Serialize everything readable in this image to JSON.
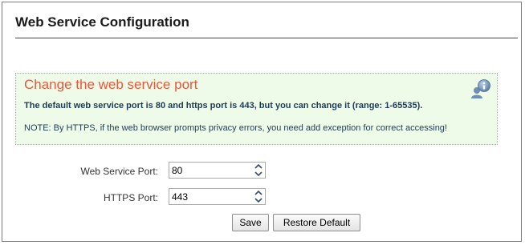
{
  "page": {
    "title": "Web Service Configuration"
  },
  "info": {
    "heading": "Change the web service port",
    "main_text": "The default web service port is 80 and https port is 443, but you can change it (range: 1-65535).",
    "note_text": "NOTE: By HTTPS, if the web browser prompts privacy errors, you need add exception for correct accessing!",
    "icon": "help-info-icon"
  },
  "form": {
    "web_port": {
      "label": "Web Service Port:",
      "value": "80"
    },
    "https_port": {
      "label": "HTTPS Port:",
      "value": "443"
    }
  },
  "actions": {
    "save_label": "Save",
    "restore_label": "Restore Default"
  },
  "colors": {
    "heading": "#e8583a",
    "info_background": "#eefbe9",
    "info_border": "#8cc27a",
    "info_text": "#1d3b52"
  }
}
